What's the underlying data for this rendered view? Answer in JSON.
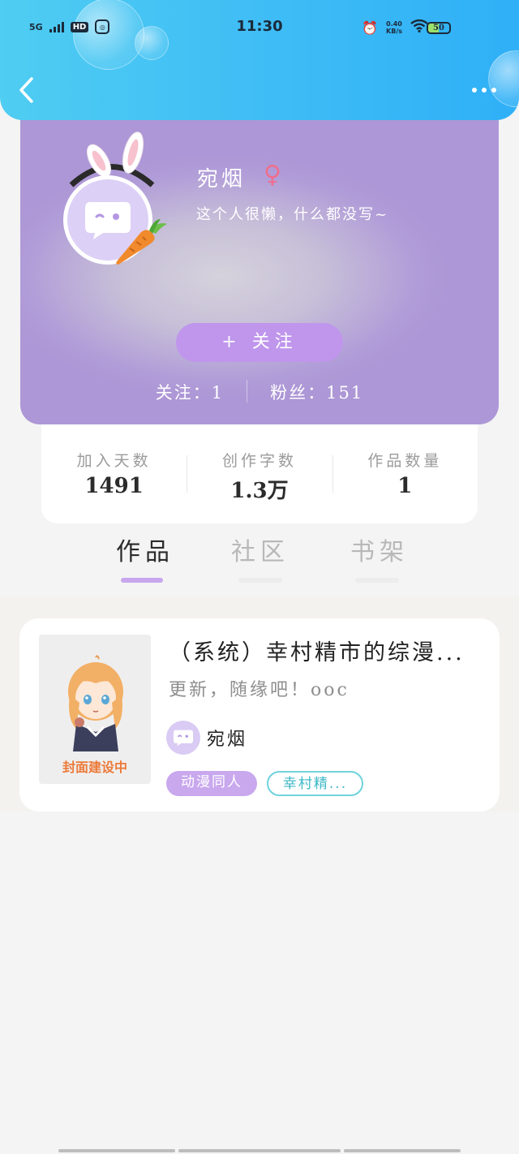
{
  "status_bar": {
    "network": "5G",
    "hd": "HD",
    "time": "11:30",
    "speed_value": "0.40",
    "speed_unit": "KB/s",
    "battery": "50"
  },
  "profile": {
    "name": "宛烟",
    "gender_symbol": "♀",
    "bio": "这个人很懒，什么都没写~",
    "follow_label": "+ 关注",
    "following": "关注：1",
    "followers": "粉丝：151"
  },
  "stats": [
    {
      "label": "加入天数",
      "value": "1491"
    },
    {
      "label": "创作字数",
      "value": "1.3万"
    },
    {
      "label": "作品数量",
      "value": "1"
    }
  ],
  "tabs": [
    {
      "label": "作品",
      "active": true
    },
    {
      "label": "社区",
      "active": false
    },
    {
      "label": "书架",
      "active": false
    }
  ],
  "works": [
    {
      "title": "（系统）幸村精市的综漫...",
      "desc": "更新，随缘吧！ooc",
      "cover_text": "封面建设中",
      "author": "宛烟",
      "tags": [
        "动漫同人",
        "幸村精..."
      ]
    }
  ],
  "colors": {
    "header": "#3fbdf5",
    "profile_bg": "#b19dd8",
    "accent": "#bf96ec",
    "tag_outline": "#6fd3dc"
  }
}
